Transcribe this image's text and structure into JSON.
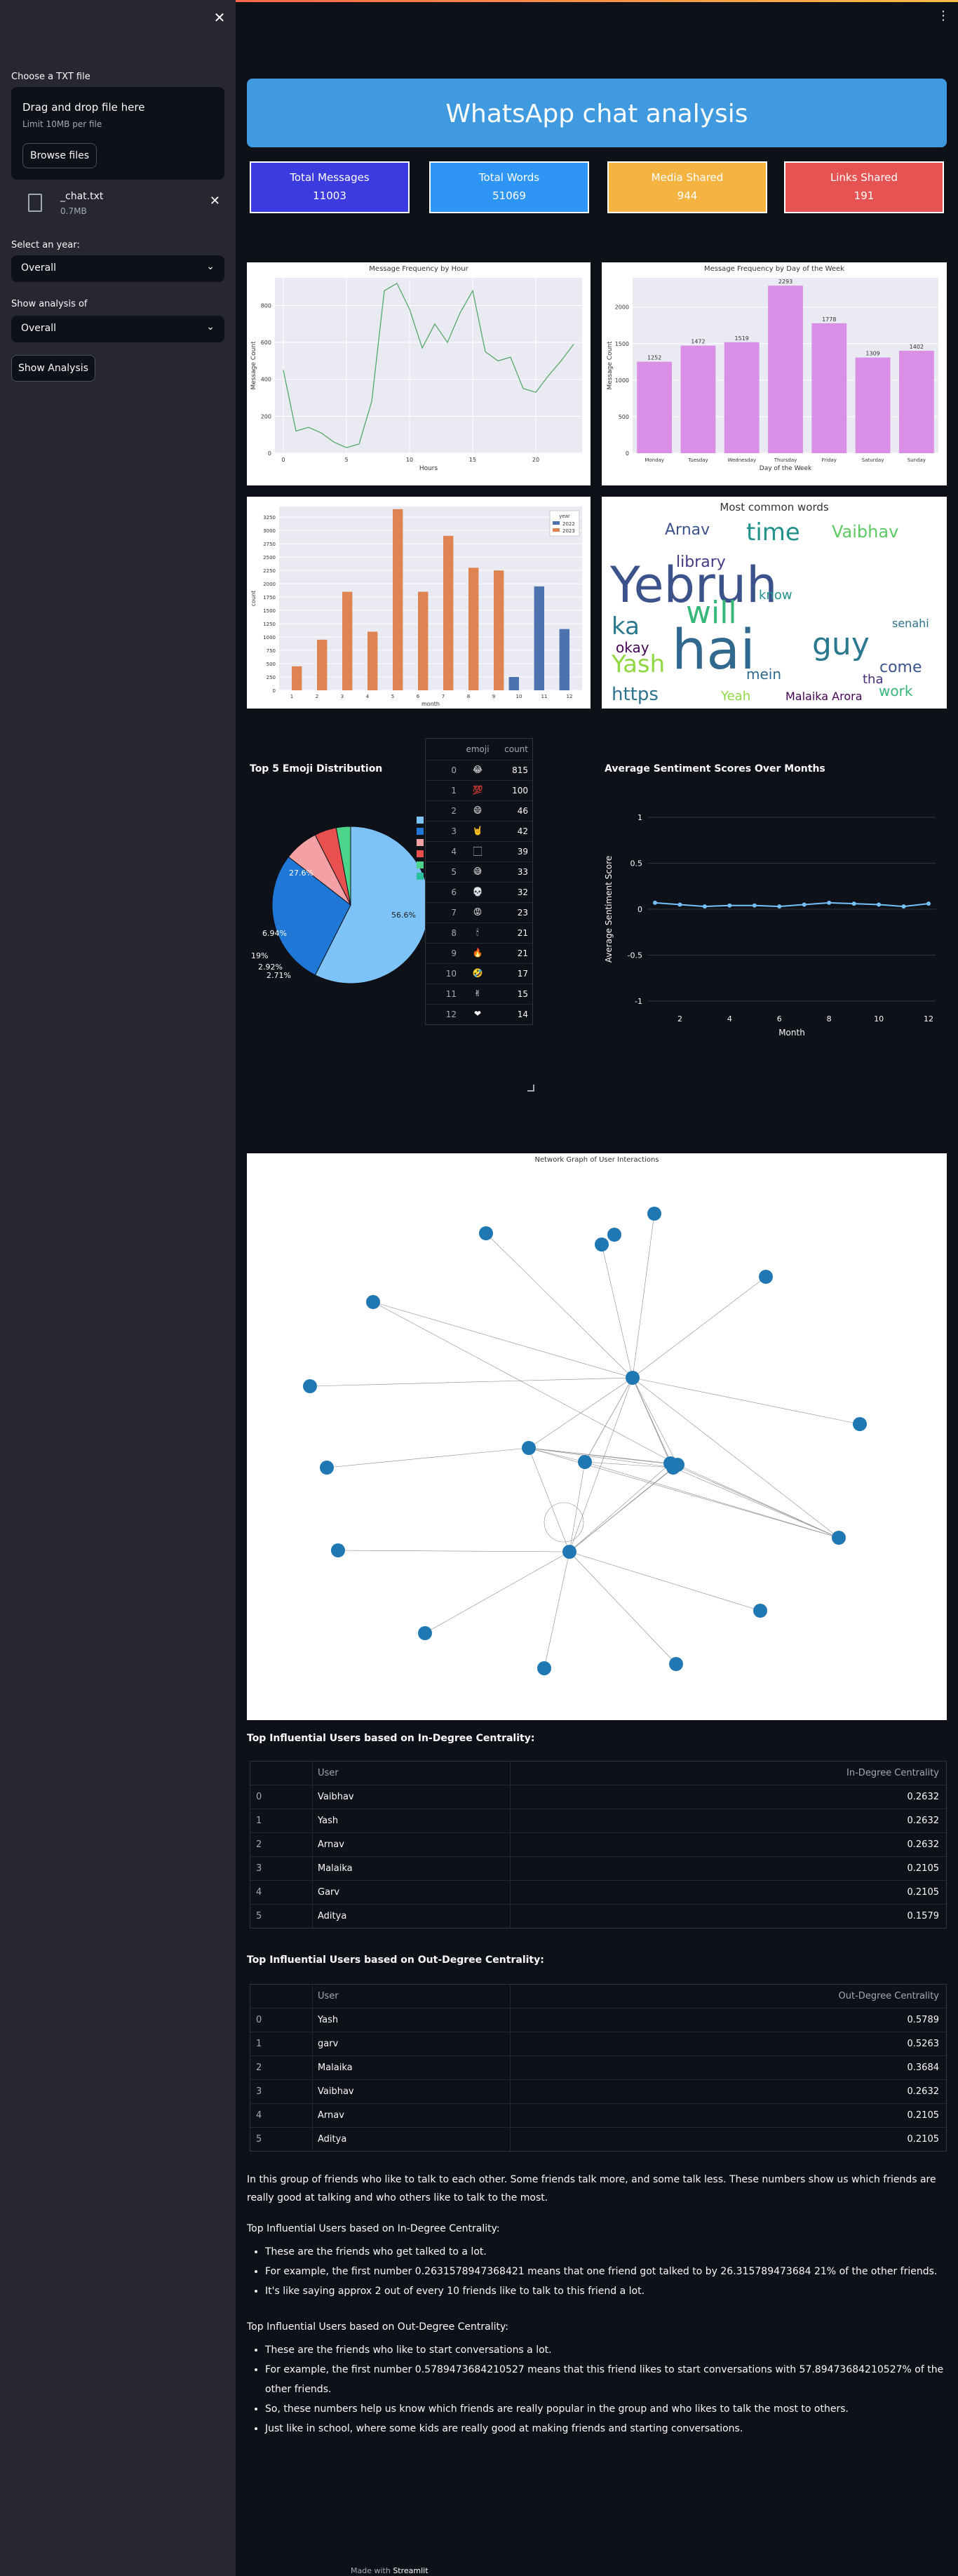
{
  "sidebar": {
    "upload_label": "Choose a TXT file",
    "drop_title": "Drag and drop file here",
    "drop_limit": "Limit 10MB per file",
    "browse_button": "Browse files",
    "file_name": "_chat.txt",
    "file_size": "0.7MB",
    "year_label": "Select an year:",
    "year_value": "Overall",
    "show_label": "Show analysis of",
    "show_value": "Overall",
    "show_button": "Show Analysis"
  },
  "header": {
    "title": "WhatsApp chat analysis"
  },
  "stats": [
    {
      "label": "Total Messages",
      "value": "11003",
      "color": "#3b3be0"
    },
    {
      "label": "Total Words",
      "value": "51069",
      "color": "#2f95f5"
    },
    {
      "label": "Media Shared",
      "value": "944",
      "color": "#f5b342"
    },
    {
      "label": "Links Shared",
      "value": "191",
      "color": "#e55353"
    }
  ],
  "charts": {
    "hourly": {
      "title": "Message Frequency by Hour",
      "xlabel": "Hours",
      "ylabel": "Message Count",
      "chart_data": {
        "type": "line",
        "x": [
          0,
          1,
          2,
          3,
          4,
          5,
          6,
          7,
          8,
          9,
          10,
          11,
          12,
          13,
          14,
          15,
          16,
          17,
          18,
          19,
          20,
          21,
          22,
          23
        ],
        "y": [
          450,
          120,
          140,
          110,
          60,
          30,
          50,
          280,
          880,
          920,
          780,
          570,
          700,
          600,
          760,
          880,
          550,
          500,
          520,
          350,
          330,
          420,
          500,
          590
        ],
        "xticks": [
          0,
          5,
          10,
          15,
          20
        ],
        "yticks": [
          0,
          200,
          400,
          600,
          800
        ],
        "ylim": [
          0,
          950
        ]
      }
    },
    "weekly": {
      "title": "Message Frequency by Day of the Week",
      "xlabel": "Day of the Week",
      "ylabel": "Message Count",
      "chart_data": {
        "type": "bar",
        "categories": [
          "Monday",
          "Tuesday",
          "Wednesday",
          "Thursday",
          "Friday",
          "Saturday",
          "Sunday"
        ],
        "values": [
          1252,
          1472,
          1519,
          2293,
          1778,
          1309,
          1402
        ],
        "yticks": [
          0,
          500,
          1000,
          1500,
          2000
        ],
        "ylim": [
          0,
          2400
        ],
        "color": "#da8fe6"
      }
    },
    "monthly": {
      "xlabel": "month",
      "ylabel": "count",
      "legend_title": "year",
      "chart_data": {
        "type": "bar",
        "categories": [
          1,
          2,
          3,
          4,
          5,
          6,
          7,
          8,
          9,
          10,
          11,
          12
        ],
        "series": [
          {
            "name": "2022",
            "color": "#4c72b0",
            "values": [
              0,
              0,
              0,
              0,
              0,
              0,
              0,
              0,
              0,
              250,
              1950,
              1150
            ]
          },
          {
            "name": "2023",
            "color": "#dd8452",
            "values": [
              450,
              950,
              1850,
              1100,
              3400,
              1850,
              2900,
              2300,
              2250,
              0,
              0,
              0
            ]
          }
        ],
        "yticks": [
          0,
          250,
          500,
          750,
          1000,
          1250,
          1500,
          1750,
          2000,
          2250,
          2500,
          2750,
          3000,
          3250
        ],
        "ylim": [
          0,
          3450
        ]
      }
    },
    "wordcloud": {
      "title": "Most common words",
      "words": [
        {
          "w": "Yebruh",
          "c": "#3b528b"
        },
        {
          "w": "hai",
          "c": "#31688e"
        },
        {
          "w": "guy",
          "c": "#2a788e"
        },
        {
          "w": "will",
          "c": "#35b779"
        },
        {
          "w": "Vaibhav",
          "c": "#5ec962"
        },
        {
          "w": "time",
          "c": "#21918c"
        },
        {
          "w": "Yash",
          "c": "#90d743"
        },
        {
          "w": "Arnav",
          "c": "#3b528b"
        },
        {
          "w": "library",
          "c": "#443983"
        },
        {
          "w": "ka",
          "c": "#2a788e"
        },
        {
          "w": "https",
          "c": "#2c728e"
        },
        {
          "w": "okay",
          "c": "#440154"
        },
        {
          "w": "come",
          "c": "#3b528b"
        },
        {
          "w": "work",
          "c": "#35b779"
        },
        {
          "w": "Malaika Arora",
          "c": "#440154"
        },
        {
          "w": "know",
          "c": "#21918c"
        },
        {
          "w": "mein",
          "c": "#31688e"
        },
        {
          "w": "Yeah",
          "c": "#90d743"
        },
        {
          "w": "tha",
          "c": "#472d7b"
        },
        {
          "w": "senahi",
          "c": "#2c728e"
        }
      ]
    },
    "emoji": {
      "title": "Top 5 Emoji Distribution",
      "chart_data": {
        "type": "pie",
        "labels": [
          "😂",
          "💯",
          "😄",
          "🤘",
          "🏻"
        ],
        "values": [
          56.6,
          27.6,
          6.94,
          4.45,
          2.92
        ],
        "colors": [
          "#7ec3f7",
          "#1f77d6",
          "#f4a1a5",
          "#e8504f",
          "#4bd48a"
        ],
        "pct_labels": [
          "56.6%",
          "27.6%",
          "6.94%",
          "19%",
          "2.92%",
          "2.71%"
        ]
      },
      "legend_colors": [
        "#7ec3f7",
        "#1f77d6",
        "#f4a1a5",
        "#e8504f",
        "#4bd48a",
        "#2abf9e"
      ],
      "table_head": [
        "emoji",
        "count"
      ],
      "rows": [
        {
          "i": "0",
          "e": "😂",
          "c": "815"
        },
        {
          "i": "1",
          "e": "💯",
          "c": "100"
        },
        {
          "i": "2",
          "e": "😄",
          "c": "46"
        },
        {
          "i": "3",
          "e": "🤘",
          "c": "42"
        },
        {
          "i": "4",
          "e": "🏻",
          "c": "39"
        },
        {
          "i": "5",
          "e": "😅",
          "c": "33"
        },
        {
          "i": "6",
          "e": "💀",
          "c": "32"
        },
        {
          "i": "7",
          "e": "😡",
          "c": "23"
        },
        {
          "i": "8",
          "e": "🕯",
          "c": "21"
        },
        {
          "i": "9",
          "e": "🔥",
          "c": "21"
        },
        {
          "i": "10",
          "e": "🤣",
          "c": "17"
        },
        {
          "i": "11",
          "e": "✌",
          "c": "15"
        },
        {
          "i": "12",
          "e": "❤",
          "c": "14"
        }
      ]
    },
    "sentiment": {
      "title": "Average Sentiment Scores Over Months",
      "xlabel": "Month",
      "ylabel": "Average Sentiment Score",
      "chart_data": {
        "type": "line",
        "x": [
          1,
          2,
          3,
          4,
          5,
          6,
          7,
          8,
          9,
          10,
          11,
          12
        ],
        "y": [
          0.07,
          0.05,
          0.03,
          0.04,
          0.04,
          0.03,
          0.05,
          0.07,
          0.06,
          0.05,
          0.03,
          0.06
        ],
        "xticks": [
          2,
          4,
          6,
          8,
          10,
          12
        ],
        "yticks": [
          -1,
          -0.5,
          0,
          0.5,
          1
        ],
        "ylim": [
          -1.1,
          1.1
        ],
        "color": "#74c0fc"
      }
    },
    "network": {
      "title": "Network Graph of User Interactions"
    }
  },
  "indegree": {
    "title": "Top Influential Users based on In-Degree Centrality:",
    "head": [
      "User",
      "In-Degree Centrality"
    ],
    "rows": [
      {
        "i": "0",
        "u": "Vaibhav",
        "v": "0.2632"
      },
      {
        "i": "1",
        "u": "Yash",
        "v": "0.2632"
      },
      {
        "i": "2",
        "u": "Arnav",
        "v": "0.2632"
      },
      {
        "i": "3",
        "u": "Malaika",
        "v": "0.2105"
      },
      {
        "i": "4",
        "u": "Garv",
        "v": "0.2105"
      },
      {
        "i": "5",
        "u": "Aditya",
        "v": "0.1579"
      }
    ]
  },
  "outdegree": {
    "title": "Top Influential Users based on Out-Degree Centrality:",
    "head": [
      "User",
      "Out-Degree Centrality"
    ],
    "rows": [
      {
        "i": "0",
        "u": "Yash",
        "v": "0.5789"
      },
      {
        "i": "1",
        "u": "garv",
        "v": "0.5263"
      },
      {
        "i": "2",
        "u": "Malaika",
        "v": "0.3684"
      },
      {
        "i": "3",
        "u": "Vaibhav",
        "v": "0.2632"
      },
      {
        "i": "4",
        "u": "Arnav",
        "v": "0.2105"
      },
      {
        "i": "5",
        "u": "Aditya",
        "v": "0.2105"
      }
    ]
  },
  "explain": {
    "intro": "In this group of friends who like to talk to each other. Some friends talk more, and some talk less. These numbers show us which friends are really good at talking and who others like to talk to the most.",
    "in_title": "Top Influential Users based on In-Degree Centrality:",
    "in_bullets": [
      "These are the friends who get talked to a lot.",
      "For example, the first number 0.2631578947368421 means that one friend got talked to by 26.315789473684 21% of the other friends.",
      "It's like saying approx 2 out of every 10 friends like to talk to this friend a lot."
    ],
    "out_title": "Top Influential Users based on Out-Degree Centrality:",
    "out_bullets": [
      "These are the friends who like to start conversations a lot.",
      "For example, the first number 0.5789473684210527 means that this friend likes to start conversations with 57.89473684210527% of the other friends.",
      "So, these numbers help us know which friends are really popular in the group and who likes to talk the most to others.",
      "Just like in school, where some kids are really good at making friends and starting conversations."
    ]
  },
  "footer": {
    "prefix": "Made with",
    "brand": "Streamlit"
  }
}
